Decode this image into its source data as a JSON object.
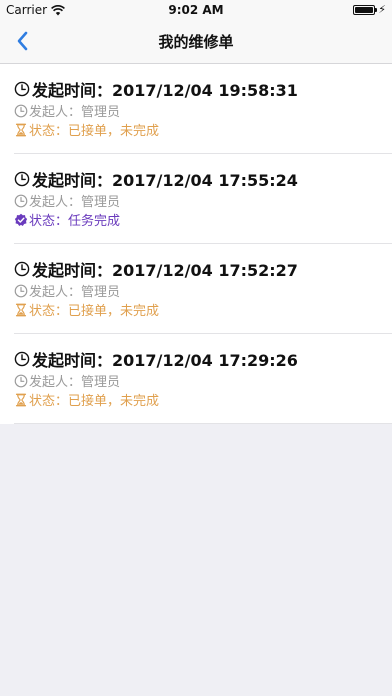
{
  "status_bar": {
    "carrier": "Carrier",
    "time": "9:02 AM",
    "icons": [
      "wifi-icon",
      "battery-icon",
      "charging-bolt-icon"
    ]
  },
  "nav": {
    "back_icon": "chevron-left-icon",
    "title": "我的维修单",
    "accent_color": "#2f7de1"
  },
  "colors": {
    "pending": "#e0a04e",
    "done": "#6a3bbd",
    "muted": "#9a9a9a"
  },
  "orders": [
    {
      "time_text": "发起时间：2017/12/04 19:58:31",
      "initiator_text": "发起人：管理员",
      "status_text": "状态：已接单，未完成",
      "status_kind": "pending",
      "status_icon": "hourglass-icon"
    },
    {
      "time_text": "发起时间：2017/12/04 17:55:24",
      "initiator_text": "发起人：管理员",
      "status_text": "状态：任务完成",
      "status_kind": "done",
      "status_icon": "verified-badge-icon"
    },
    {
      "time_text": "发起时间：2017/12/04 17:52:27",
      "initiator_text": "发起人：管理员",
      "status_text": "状态：已接单，未完成",
      "status_kind": "pending",
      "status_icon": "hourglass-icon"
    },
    {
      "time_text": "发起时间：2017/12/04 17:29:26",
      "initiator_text": "发起人：管理员",
      "status_text": "状态：已接单，未完成",
      "status_kind": "pending",
      "status_icon": "hourglass-icon"
    }
  ]
}
